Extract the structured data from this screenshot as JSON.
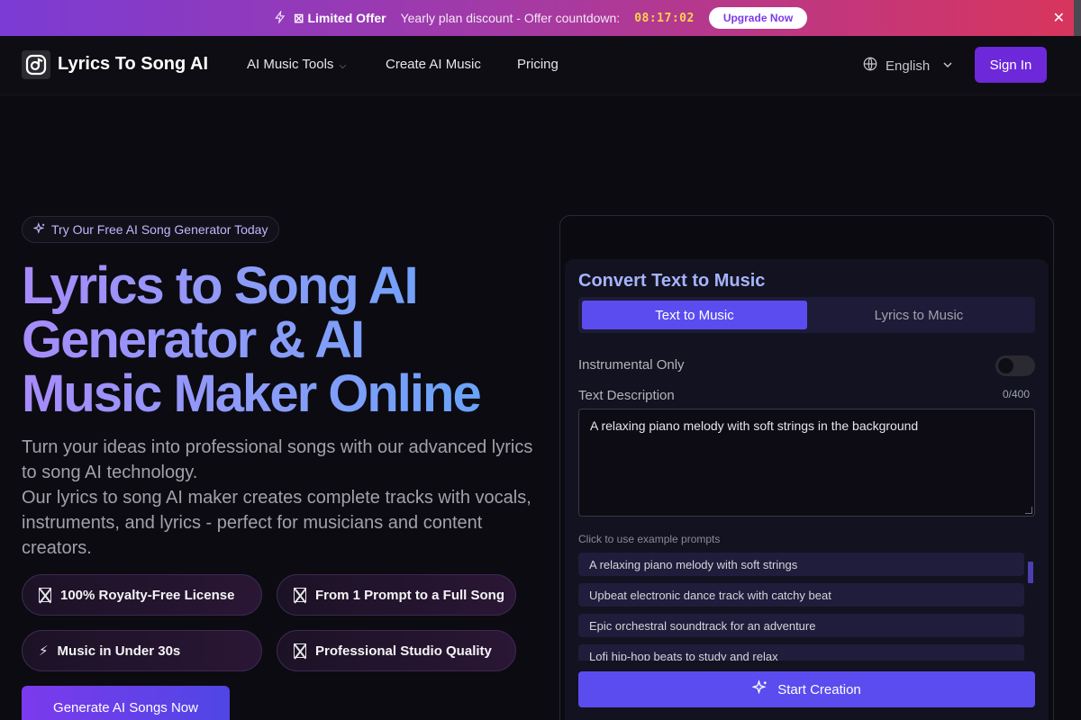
{
  "promo": {
    "icon": "bolt-icon",
    "offer_label": "Limited Offer",
    "description": "Yearly plan discount - Offer countdown:",
    "countdown": "08:17:02",
    "upgrade_label": "Upgrade Now",
    "close_symbol": "✕"
  },
  "header": {
    "brand": "Lyrics To Song AI",
    "nav": {
      "tools": "AI Music Tools",
      "create": "Create AI Music",
      "pricing": "Pricing"
    },
    "language": "English",
    "sign_in": "Sign In"
  },
  "hero": {
    "badge": "Try Our Free AI Song Generator Today",
    "headline_line1": "Lyrics to Song AI",
    "headline_line2": "Generator & AI",
    "headline_line3": "Music Maker Online",
    "sub_p1": "Turn your ideas into professional songs with our advanced lyrics to song AI technology.",
    "sub_p2": "Our lyrics to song AI maker creates complete tracks with vocals, instruments, and lyrics - perfect for musicians and content creators.",
    "features": {
      "f1": "100% Royalty-Free License",
      "f2": "From 1 Prompt to a Full Song",
      "f3": "Music in Under 30s",
      "f4": "Professional Studio Quality"
    },
    "cta": "Generate AI Songs Now"
  },
  "generator": {
    "title": "Convert Text to Music",
    "tab_text": "Text to Music",
    "tab_lyrics": "Lyrics to Music",
    "instrumental_label": "Instrumental Only",
    "instrumental_on": false,
    "description_label": "Text Description",
    "char_count": "0/400",
    "description_value": "A relaxing piano melody with soft strings in the background",
    "examples_label": "Click to use example prompts",
    "examples": {
      "e1": "A relaxing piano melody with soft strings",
      "e2": "Upbeat electronic dance track with catchy beat",
      "e3": "Epic orchestral soundtrack for an adventure",
      "e4": "Lofi hip-hop beats to study and relax"
    },
    "start_label": "Start Creation"
  },
  "colors": {
    "accent": "#5b4cf0",
    "brand_purple": "#6d28d9",
    "timer": "#fcd34d"
  }
}
